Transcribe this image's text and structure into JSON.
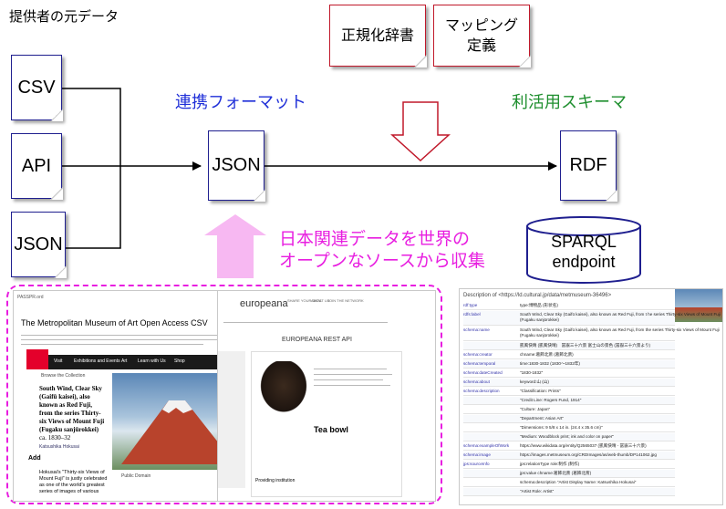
{
  "provider_title": "提供者の元データ",
  "sources": [
    "CSV",
    "API",
    "JSON"
  ],
  "intermediate": "JSON",
  "output": "RDF",
  "red_docs": {
    "normalization": "正規化辞書",
    "mapping": [
      "マッピング",
      "定義"
    ]
  },
  "label_format": "連携フォーマット",
  "label_schema": "利活用スキーマ",
  "collection_text": [
    "日本関連データを世界の",
    "オープンなソースから収集"
  ],
  "sparql": [
    "SPARQL",
    "endpoint"
  ],
  "colors": {
    "blue_label": "#1f2fd8",
    "green_label": "#1f8f2f",
    "magenta": "#e81ee0",
    "pink_arrow": "#f7b8f2",
    "doc_border_blue": "#1f1f8f",
    "doc_border_red": "#c0182a"
  },
  "shot_met": {
    "logo": "PASSPR.ord",
    "title": "The Metropolitan Museum of Art Open Access CSV",
    "nav": [
      "Visit",
      "Exhibitions and Events",
      "Art",
      "Learn with Us",
      "Shop"
    ],
    "back": "Browse the Collection",
    "art_title": [
      "South Wind, Clear Sky",
      "(Gaifū kaisei), also",
      "known as Red Fuji,",
      "from the series Thirty-",
      "six Views of Mount Fuji",
      "(Fugaku sanjūrokkei)",
      "ca. 1830–32"
    ],
    "artist": "Katsushika Hokusai",
    "desc": [
      "Hokusai's \"Thirty-six Views of",
      "Mount Fuji\" is justly celebrated",
      "as one of the world's greatest",
      "series of images of various"
    ],
    "add": "Add",
    "public_domain": "Public Domain"
  },
  "shot_europeana": {
    "logo": "europeana",
    "api_title": "EUROPEANA REST API",
    "item_title": "Tea bowl",
    "provider_label": "Providing institution",
    "menu": [
      "SHARE YOUR DATA",
      "ABOUT US",
      "JOIN THE NETWORK"
    ]
  },
  "shot_rdf": {
    "header": "Description of <https://ld.cultural.jp/data/metmuseum-36496>",
    "rows": [
      [
        "rdf:type",
        "type:博物品 (形状名)"
      ],
      [
        "rdfs:label",
        "South Wind, Clear Sky (Gaifū kaisei), also known as Red Fuji, from t he series Thirty-six Views of Mount Fuji (Fugaku sanjūrokkei)"
      ],
      [
        "schema:name",
        "South Wind, Clear Sky (Gaifū kaisei), also known as Red Fuji, from the series Thirty-six Views of Mount Fuji (Fugaku sanjūrokkei)"
      ],
      [
        "",
        "凱風快晴 (凱風快晴)　冨嶽三十六景 富士山の景色 (冨嶽三十六景より)"
      ],
      [
        "schema:creator",
        "chname:葛飾北斎 (葛飾北斎)"
      ],
      [
        "schema:temporal",
        "time:1830-1832 (1830〜1832年)"
      ],
      [
        "schema:dateCreated",
        "\"1830-1832\""
      ],
      [
        "schema:about",
        "keyword:山 (山)"
      ],
      [
        "schema:description",
        "\"Classification: Prints\""
      ],
      [
        "",
        "\"Credit Line: Rogers Fund, 1914\""
      ],
      [
        "",
        "\"Culture: Japan\""
      ],
      [
        "",
        "\"Department: Asian Art\""
      ],
      [
        "",
        "\"Dimensions: 9 5/8 x 14 in. (24.4 x 35.6 cm)\""
      ],
      [
        "",
        "\"Medium: Woodblock print; ink and color on paper\""
      ],
      [
        "schema:exampleOfWork",
        "https://www.wikidata.org/entity/Q2565037 (凱風快晴 - 冨嶽三十六景)"
      ],
      [
        "schema:image",
        "https://images.metmuseum.org/CRDImages/as/web-thumb/DP141062.jpg"
      ],
      [
        "jps:sourceInfo",
        "jps:relationType  role:制作 (制作)"
      ],
      [
        "",
        "jps:value  chname:葛飾北斎 (葛飾北斎)"
      ],
      [
        "",
        "schema:description  \"Artist Display Name: Katsushika Hokusai\""
      ],
      [
        "",
        "\"Artist Role: Artist\""
      ]
    ]
  }
}
